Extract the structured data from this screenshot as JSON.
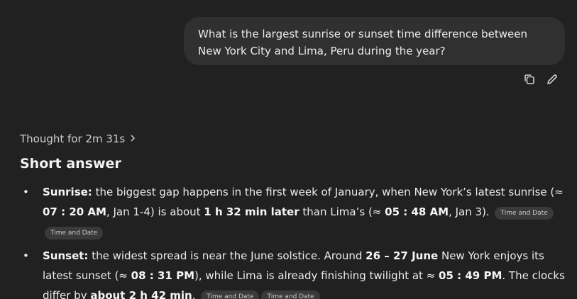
{
  "user_message": {
    "text": "What is the largest sunrise or sunset time difference between New York City and Lima, Peru during the year?"
  },
  "message_actions": {
    "copy_icon": "copy-icon",
    "edit_icon": "pencil-icon"
  },
  "thought": {
    "label": "Thought for 2m 31s",
    "chevron": "›"
  },
  "answer": {
    "heading": "Short answer",
    "bullet_glyph": "•",
    "sunrise": {
      "label": "Sunrise:",
      "t1": " the biggest gap happens in the first week of January, when New York’s latest sunrise (≈ ",
      "b1": "07 : 20 AM",
      "t2": ", Jan 1-4) is about ",
      "b2": "1 h 32 min later",
      "t3": " than Lima’s (≈ ",
      "b3": "05 : 48 AM",
      "t4": ", Jan 3).",
      "chips": [
        "Time and Date",
        "Time and Date"
      ]
    },
    "sunset": {
      "label": "Sunset:",
      "t1": " the widest spread is near the June solstice. Around ",
      "b1": "26 – 27 June",
      "t2": " New York enjoys its latest sunset (≈ ",
      "b2": "08 : 31 PM",
      "t3": "), while Lima is already finishing twilight at ≈ ",
      "b3": "05 : 49 PM",
      "t4": ". The clocks differ by ",
      "b4": "about 2 h 42 min",
      "t5": ".",
      "chips": [
        "Time and Date",
        "Time and Date"
      ]
    }
  }
}
